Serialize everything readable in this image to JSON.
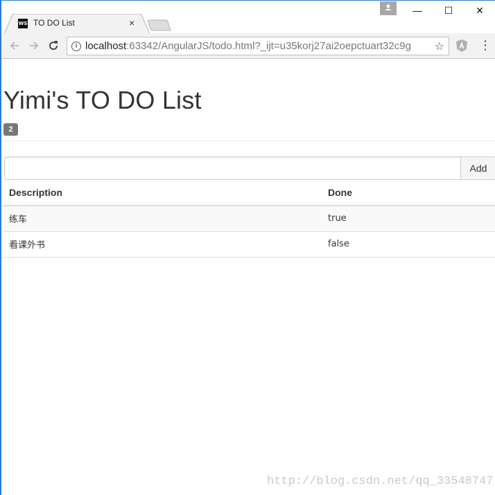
{
  "browser": {
    "tab_title": "TO DO List",
    "favicon_text": "WS",
    "close_glyph": "×",
    "url_host": "localhost",
    "url_rest": ":63342/AngularJS/todo.html?_ijt=u35korj27ai2oepctuart32c9g",
    "controls": {
      "minimize": "—",
      "maximize": "☐",
      "close": "✕"
    },
    "icons": {
      "back": "back-arrow-icon",
      "forward": "forward-arrow-icon",
      "reload": "reload-icon",
      "info": "info-icon",
      "star": "star-icon",
      "extension": "angular-extension-icon",
      "menu": "kebab-menu-icon",
      "profile": "profile-icon"
    }
  },
  "page": {
    "title": "Yimi's TO DO List",
    "incomplete_count": "2",
    "input": {
      "value": "",
      "placeholder": ""
    },
    "add_label": "Add",
    "table": {
      "headers": {
        "description": "Description",
        "done": "Done"
      },
      "rows": [
        {
          "description": "练车",
          "done": "true"
        },
        {
          "description": "看课外书",
          "done": "false"
        }
      ]
    }
  },
  "watermark": "http://blog.csdn.net/qq_33548747",
  "colors": {
    "window_border": "#2b7bd3",
    "badge": "#777777",
    "toolbar": "#f2f2f2"
  }
}
